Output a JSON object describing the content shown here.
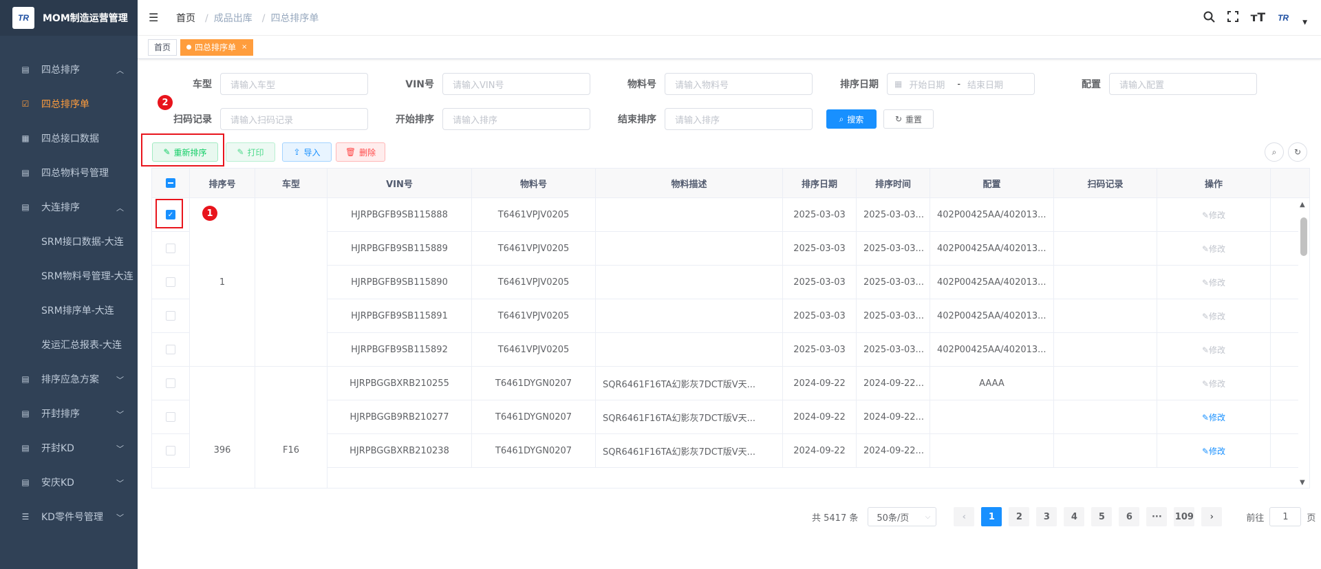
{
  "app": {
    "logo_text": "TR",
    "title": "MOM制造运营管理"
  },
  "sidebar": {
    "items": [
      {
        "label": "四总排序",
        "icon": "table-icon",
        "arrow": "up"
      },
      {
        "label": "四总排序单",
        "icon": "checkbox-icon",
        "active": true
      },
      {
        "label": "四总接口数据",
        "icon": "grid-icon"
      },
      {
        "label": "四总物料号管理",
        "icon": "table-icon"
      },
      {
        "label": "大连排序",
        "icon": "table-icon",
        "arrow": "up"
      },
      {
        "label": "SRM接口数据-大连",
        "sub": true
      },
      {
        "label": "SRM物料号管理-大连",
        "sub": true
      },
      {
        "label": "SRM排序单-大连",
        "sub": true
      },
      {
        "label": "发运汇总报表-大连",
        "sub": true
      },
      {
        "label": "排序应急方案",
        "icon": "table-icon",
        "arrow": "down"
      },
      {
        "label": "开封排序",
        "icon": "table-icon",
        "arrow": "down"
      },
      {
        "label": "开封KD",
        "icon": "table-icon",
        "arrow": "down"
      },
      {
        "label": "安庆KD",
        "icon": "table-icon",
        "arrow": "down"
      },
      {
        "label": "KD零件号管理",
        "icon": "list-icon",
        "arrow": "down"
      }
    ]
  },
  "header": {
    "breadcrumb": [
      "首页",
      "成品出库",
      "四总排序单"
    ],
    "avatar_text": "TR"
  },
  "tags": {
    "home": "首页",
    "current": "四总排序单",
    "close": "×"
  },
  "form": {
    "car_type": {
      "label": "车型",
      "placeholder": "请输入车型"
    },
    "vin": {
      "label": "VIN号",
      "placeholder": "请输入VIN号"
    },
    "material": {
      "label": "物料号",
      "placeholder": "请输入物料号"
    },
    "date": {
      "label": "排序日期",
      "start": "开始日期",
      "sep": "-",
      "end": "结束日期"
    },
    "config": {
      "label": "配置",
      "placeholder": "请输入配置"
    },
    "scan": {
      "label": "扫码记录",
      "placeholder": "请输入扫码记录"
    },
    "start_seq": {
      "label": "开始排序",
      "placeholder": "请输入排序"
    },
    "end_seq": {
      "label": "结束排序",
      "placeholder": "请输入排序"
    },
    "search": "搜索",
    "reset": "重置"
  },
  "toolbar": {
    "resort": "重新排序",
    "print": "打印",
    "import": "导入",
    "delete": "删除"
  },
  "annotations": {
    "badge1": "1",
    "badge2": "2"
  },
  "table": {
    "headers": [
      "排序号",
      "车型",
      "VIN号",
      "物料号",
      "物料描述",
      "排序日期",
      "排序时间",
      "配置",
      "扫码记录",
      "操作"
    ],
    "edit_label": "修改",
    "groups": [
      {
        "seq": "1",
        "car": ""
      },
      {
        "seq": "396",
        "car": "F16"
      }
    ],
    "rows": [
      {
        "vin": "HJRPBGFB9SB115888",
        "mat": "T6461VPJV0205",
        "desc": "",
        "date": "2025-03-03",
        "time": "2025-03-03...",
        "config": "402P00425AA/402013...",
        "scan": "",
        "checked": true,
        "op_active": false
      },
      {
        "vin": "HJRPBGFB9SB115889",
        "mat": "T6461VPJV0205",
        "desc": "",
        "date": "2025-03-03",
        "time": "2025-03-03...",
        "config": "402P00425AA/402013...",
        "scan": "",
        "checked": false,
        "op_active": false
      },
      {
        "vin": "HJRPBGFB9SB115890",
        "mat": "T6461VPJV0205",
        "desc": "",
        "date": "2025-03-03",
        "time": "2025-03-03...",
        "config": "402P00425AA/402013...",
        "scan": "",
        "checked": false,
        "op_active": false
      },
      {
        "vin": "HJRPBGFB9SB115891",
        "mat": "T6461VPJV0205",
        "desc": "",
        "date": "2025-03-03",
        "time": "2025-03-03...",
        "config": "402P00425AA/402013...",
        "scan": "",
        "checked": false,
        "op_active": false
      },
      {
        "vin": "HJRPBGFB9SB115892",
        "mat": "T6461VPJV0205",
        "desc": "",
        "date": "2025-03-03",
        "time": "2025-03-03...",
        "config": "402P00425AA/402013...",
        "scan": "",
        "checked": false,
        "op_active": false
      },
      {
        "vin": "HJRPBGGBXRB210255",
        "mat": "T6461DYGN0207",
        "desc": "SQR6461F16TA幻影灰7DCT版Ⅴ天...",
        "date": "2024-09-22",
        "time": "2024-09-22...",
        "config": "AAAA",
        "scan": "",
        "checked": false,
        "op_active": false
      },
      {
        "vin": "HJRPBGGB9RB210277",
        "mat": "T6461DYGN0207",
        "desc": "SQR6461F16TA幻影灰7DCT版Ⅴ天...",
        "date": "2024-09-22",
        "time": "2024-09-22...",
        "config": "",
        "scan": "",
        "checked": false,
        "op_active": true
      },
      {
        "vin": "HJRPBGGBXRB210238",
        "mat": "T6461DYGN0207",
        "desc": "SQR6461F16TA幻影灰7DCT版Ⅴ天...",
        "date": "2024-09-22",
        "time": "2024-09-22...",
        "config": "",
        "scan": "",
        "checked": false,
        "op_active": true
      }
    ]
  },
  "pagination": {
    "total": "共 5417 条",
    "page_size": "50条/页",
    "pages": [
      "1",
      "2",
      "3",
      "4",
      "5",
      "6",
      "···",
      "109"
    ],
    "current": "1",
    "goto_prefix": "前往",
    "goto_value": "1",
    "goto_suffix": "页"
  },
  "colors": {
    "sidebar_bg": "#304156",
    "accent": "#ff9d3d",
    "primary": "#1890ff",
    "annotation": "#e8141c"
  }
}
